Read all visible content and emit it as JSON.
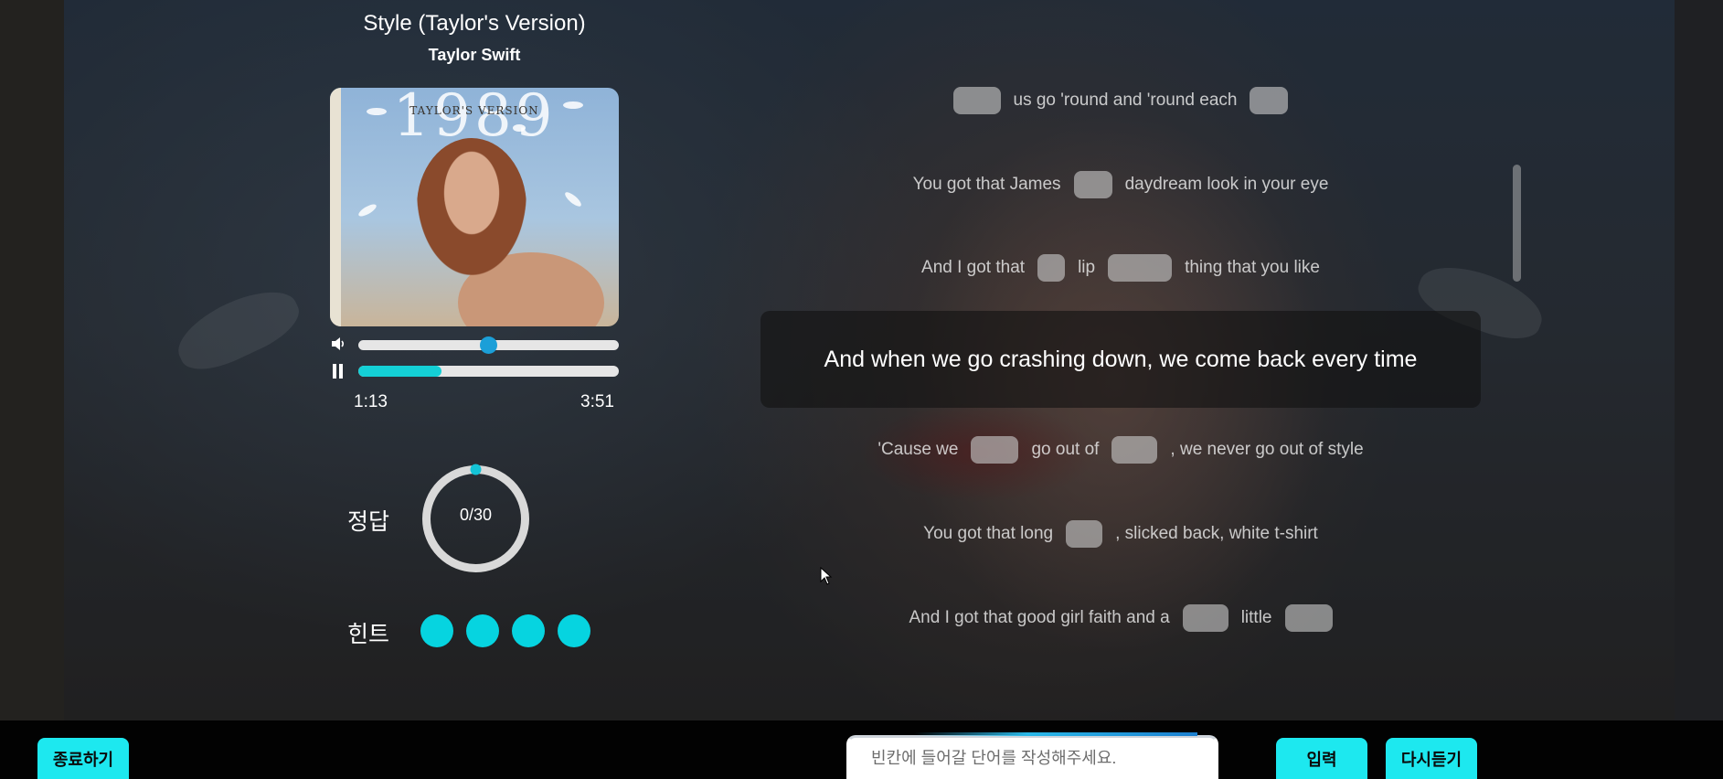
{
  "player": {
    "title": "Style (Taylor's Version)",
    "artist": "Taylor Swift",
    "album_cover": {
      "number": "1989",
      "edition": "TAYLOR'S VERSION"
    },
    "volume_level": 0.5,
    "progress_fraction": 0.32,
    "time_elapsed": "1:13",
    "time_total": "3:51",
    "volume_icon": "speaker-icon",
    "pause_icon": "pause-icon"
  },
  "score": {
    "label": "정답",
    "value_text": "0/30",
    "correct": 0,
    "total": 30
  },
  "hints": {
    "label": "힌트",
    "remaining": 4
  },
  "lyrics": {
    "lines": [
      {
        "segments": [
          "",
          "us go 'round and 'round each",
          ""
        ]
      },
      {
        "segments": [
          "You got that James",
          "",
          "daydream look in your eye"
        ]
      },
      {
        "segments": [
          "And I got that",
          "",
          "lip",
          "",
          "thing that you like"
        ]
      },
      {
        "current": "And when we go crashing down, we come back every time"
      },
      {
        "segments": [
          "'Cause we",
          "",
          "go out of",
          "",
          ", we never go out of style"
        ]
      },
      {
        "segments": [
          "You got that long",
          "",
          ", slicked back, white t-shirt"
        ]
      },
      {
        "segments": [
          "And I got that good girl faith and a",
          "",
          "little",
          ""
        ]
      }
    ]
  },
  "bottom_bar": {
    "quit_label": "종료하기",
    "input_placeholder": "빈칸에 들어갈 단어를 작성해주세요.",
    "input_value": "",
    "submit_label": "입력",
    "replay_label": "다시듣기"
  },
  "colors": {
    "accent": "#1de8ef",
    "hint_dot": "#06d4e0",
    "progress": "#14d0d6",
    "volume_knob": "#1b9fd8",
    "bottom_bar": "#020202"
  }
}
